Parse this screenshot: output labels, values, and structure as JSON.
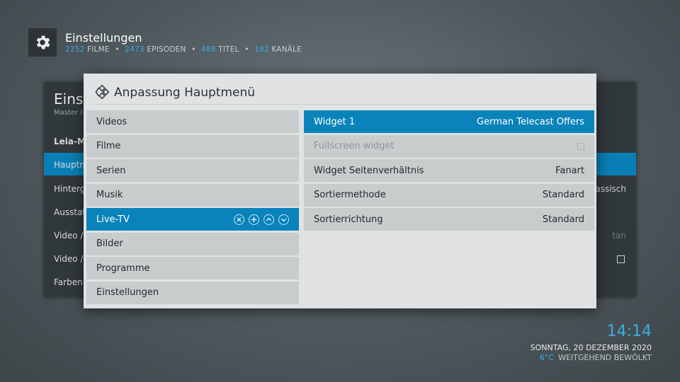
{
  "header": {
    "title": "Einstellungen",
    "stats": {
      "films_count": "2252",
      "films_label": "FILME",
      "episodes_count": "2473",
      "episodes_label": "EPISODEN",
      "titles_count": "488",
      "titles_label": "TITEL",
      "channels_count": "182",
      "channels_label": "KANÄLE"
    }
  },
  "background_panel": {
    "title": "Einst",
    "subtitle": "Master I",
    "rows": [
      "Leia-M",
      "Hauptm",
      "Hinterg",
      "Ausstat",
      "Video /",
      "Video /",
      "Farben"
    ],
    "right_value": "assisch",
    "right_value2": "tan"
  },
  "dialog": {
    "title": "Anpassung Hauptmenü",
    "menu_items": [
      "Videos",
      "Filme",
      "Serien",
      "Musik",
      "Live-TV",
      "Bilder",
      "Programme",
      "Einstellungen"
    ],
    "active_index": 4,
    "settings": [
      {
        "label": "Widget 1",
        "value": "German Telecast Offers"
      },
      {
        "label": "Fullscreen widget",
        "value": ""
      },
      {
        "label": "Widget Seitenverhältnis",
        "value": "Fanart"
      },
      {
        "label": "Sortiermethode",
        "value": "Standard"
      },
      {
        "label": "Sortierrichtung",
        "value": "Standard"
      }
    ]
  },
  "clock": {
    "time": "14:14",
    "date": "SONNTAG, 20 DEZEMBER 2020",
    "temperature": "6°C",
    "weather": "WEITGEHEND BEWÖLKT"
  },
  "colors": {
    "accent": "#0a83ba",
    "highlight_text": "#39a9e0"
  }
}
